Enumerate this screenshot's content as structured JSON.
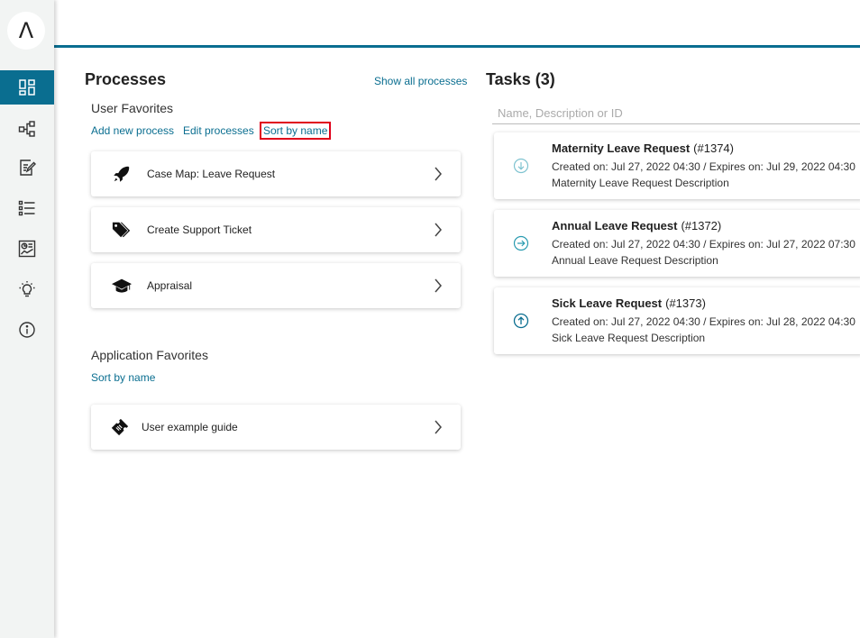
{
  "colors": {
    "accent": "#0a6e90",
    "highlight": "#e0001a"
  },
  "sidebar": {
    "logo_glyph": "Λ",
    "items": [
      {
        "name": "dashboard-icon",
        "active": true
      },
      {
        "name": "process-map-icon",
        "active": false
      },
      {
        "name": "edit-task-icon",
        "active": false
      },
      {
        "name": "list-icon",
        "active": false
      },
      {
        "name": "statistics-icon",
        "active": false
      },
      {
        "name": "lightbulb-icon",
        "active": false
      },
      {
        "name": "info-icon",
        "active": false
      }
    ]
  },
  "processes": {
    "title": "Processes",
    "show_all": "Show all processes",
    "user_favorites": {
      "title": "User Favorites",
      "add_new": "Add new process",
      "edit": "Edit processes",
      "sort": "Sort by name",
      "items": [
        {
          "label": "Case Map: Leave Request",
          "icon": "rocket-icon"
        },
        {
          "label": "Create Support Ticket",
          "icon": "tags-icon"
        },
        {
          "label": "Appraisal",
          "icon": "graduation-cap-icon"
        }
      ]
    },
    "app_favorites": {
      "title": "Application Favorites",
      "sort": "Sort by name",
      "items": [
        {
          "label": "User example guide",
          "icon": "ticket-icon"
        }
      ]
    }
  },
  "tasks": {
    "title": "Tasks (3)",
    "search_placeholder": "Name, Description or ID",
    "items": [
      {
        "name": "Maternity Leave Request",
        "id": "(#1374)",
        "meta": "Created on: Jul 27, 2022 04:30 / Expires on: Jul 29, 2022 04:30",
        "description": "Maternity Leave Request Description",
        "priority_icon": "arrow-down-circle-icon"
      },
      {
        "name": "Annual Leave Request",
        "id": "(#1372)",
        "meta": "Created on: Jul 27, 2022 04:30 / Expires on: Jul 27, 2022 07:30",
        "description": "Annual Leave Request Description",
        "priority_icon": "arrow-right-circle-icon"
      },
      {
        "name": "Sick Leave Request",
        "id": "(#1373)",
        "meta": "Created on: Jul 27, 2022 04:30 / Expires on: Jul 28, 2022 04:30",
        "description": "Sick Leave Request Description",
        "priority_icon": "arrow-up-circle-icon"
      }
    ]
  }
}
